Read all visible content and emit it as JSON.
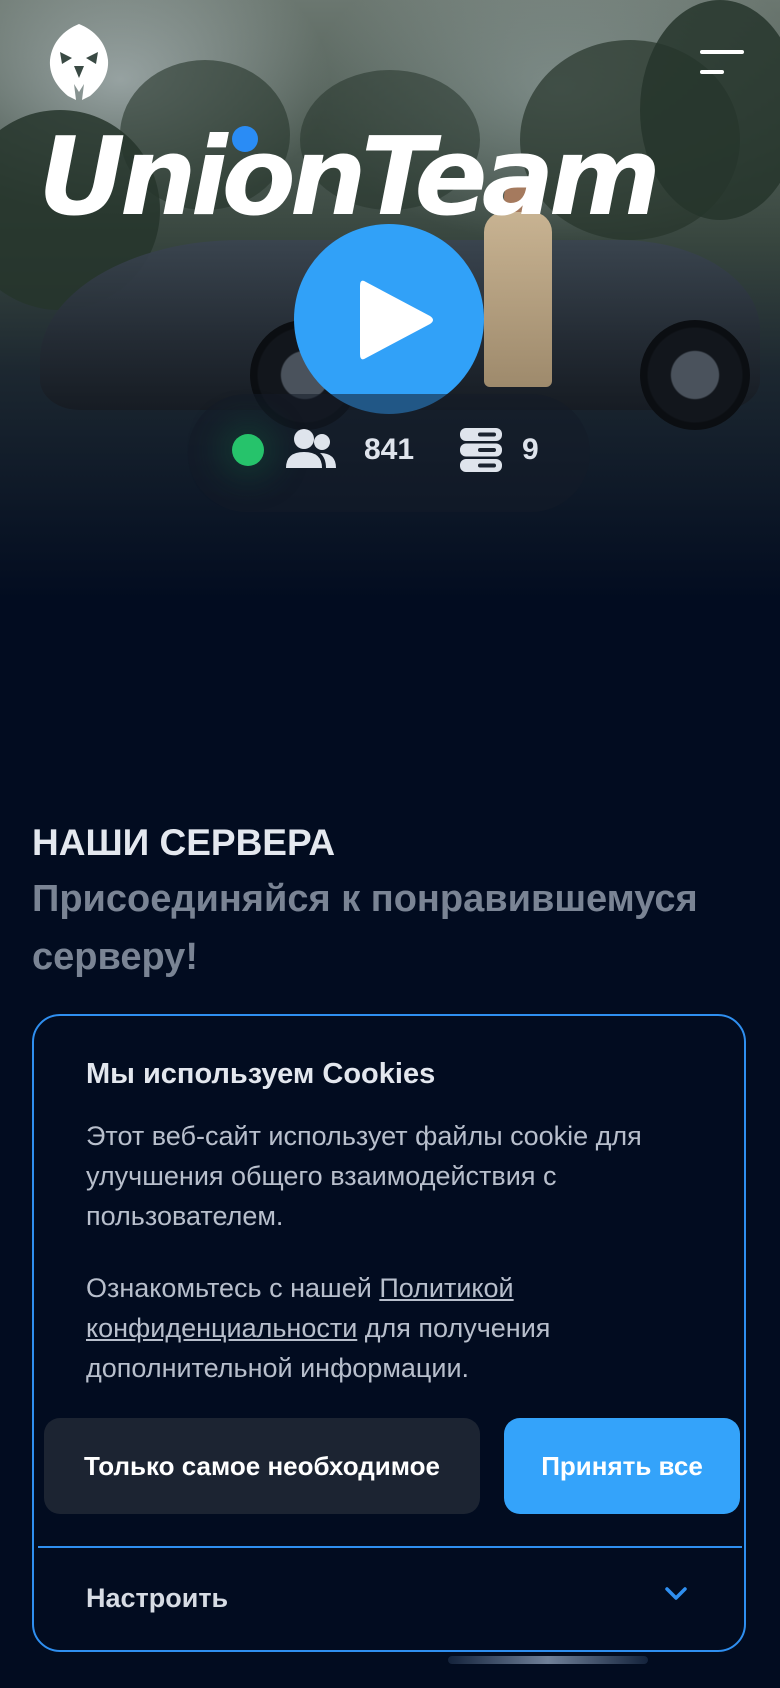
{
  "header": {
    "logo_icon": "eagle-logo-icon",
    "menu_icon": "hamburger-menu-icon"
  },
  "hero": {
    "brand": "UnionTeam",
    "play_icon": "play-icon",
    "stats": {
      "online_indicator_color": "#26c36b",
      "players_icon": "users-icon",
      "players_count": "841",
      "servers_icon": "server-icon",
      "servers_count": "9"
    }
  },
  "servers_section": {
    "title": "НАШИ СЕРВЕРА",
    "subtitle": "Присоединяйся к понравившемуся серверу!"
  },
  "cookie_banner": {
    "title": "Мы используем Cookies",
    "text": "Этот веб-сайт использует файлы cookie для улучшения общего взаимодействия с пользователем.",
    "policy_prefix": "Ознакомьтесь с нашей",
    "policy_link": "Политикой конфиденциальности",
    "policy_suffix": "для получения дополнительной информации.",
    "necessary_button": "Только самое необходимое",
    "accept_button": "Принять все",
    "settings_label": "Настроить",
    "settings_icon": "chevron-down-icon"
  },
  "colors": {
    "accent": "#34a3fa",
    "background": "#020c20",
    "border": "#2f8ff0"
  }
}
